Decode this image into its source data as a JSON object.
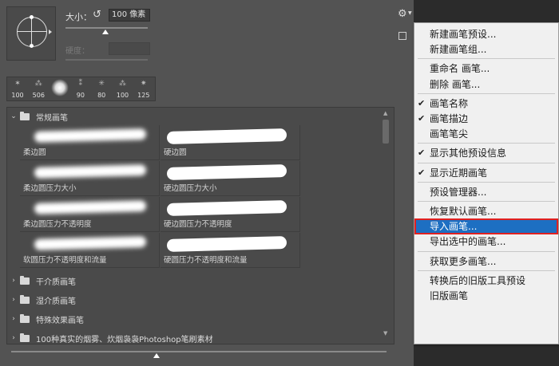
{
  "top": {
    "size_label": "大小：",
    "size_value": "100 像素",
    "hardness_label": "硬度：",
    "reset_icon": "reset-icon",
    "size_slider_fraction": 0.5
  },
  "presets": [
    {
      "num": "100",
      "glyph": "✶"
    },
    {
      "num": "506",
      "glyph": "⁂"
    },
    {
      "num": "",
      "glyph": "soft"
    },
    {
      "num": "90",
      "glyph": "⁑"
    },
    {
      "num": "80",
      "glyph": "✳"
    },
    {
      "num": "100",
      "glyph": "⁂"
    },
    {
      "num": "125",
      "glyph": "✷"
    }
  ],
  "groups": {
    "expanded": {
      "label": "常规画笔"
    },
    "brushes": [
      {
        "label": "柔边圆",
        "hard": false
      },
      {
        "label": "硬边圆",
        "hard": true
      },
      {
        "label": "柔边圆压力大小",
        "hard": false
      },
      {
        "label": "硬边圆压力大小",
        "hard": true
      },
      {
        "label": "柔边圆压力不透明度",
        "hard": false
      },
      {
        "label": "硬边圆压力不透明度",
        "hard": true
      },
      {
        "label": "软圆压力不透明度和流量",
        "hard": false
      },
      {
        "label": "硬圆压力不透明度和流量",
        "hard": true
      }
    ],
    "collapsed": [
      "干介质画笔",
      "湿介质画笔",
      "特殊效果画笔",
      "100种真实的烟雾、炊烟袅袅Photoshop笔刷素材"
    ]
  },
  "menu": {
    "items": [
      {
        "label": "新建画笔预设...",
        "checked": false,
        "highlighted": false
      },
      {
        "label": "新建画笔组...",
        "checked": false,
        "highlighted": false
      },
      {
        "sep": true
      },
      {
        "label": "重命名 画笔...",
        "checked": false,
        "highlighted": false
      },
      {
        "label": "删除 画笔...",
        "checked": false,
        "highlighted": false
      },
      {
        "sep": true
      },
      {
        "label": "画笔名称",
        "checked": true,
        "highlighted": false
      },
      {
        "label": "画笔描边",
        "checked": true,
        "highlighted": false
      },
      {
        "label": "画笔笔尖",
        "checked": false,
        "highlighted": false
      },
      {
        "sep": true
      },
      {
        "label": "显示其他预设信息",
        "checked": true,
        "highlighted": false
      },
      {
        "sep": true
      },
      {
        "label": "显示近期画笔",
        "checked": true,
        "highlighted": false
      },
      {
        "sep": true
      },
      {
        "label": "预设管理器...",
        "checked": false,
        "highlighted": false
      },
      {
        "sep": true
      },
      {
        "label": "恢复默认画笔...",
        "checked": false,
        "highlighted": false
      },
      {
        "label": "导入画笔...",
        "checked": false,
        "highlighted": true
      },
      {
        "label": "导出选中的画笔...",
        "checked": false,
        "highlighted": false
      },
      {
        "sep": true
      },
      {
        "label": "获取更多画笔...",
        "checked": false,
        "highlighted": false
      },
      {
        "sep": true
      },
      {
        "label": "转换后的旧版工具预设",
        "checked": false,
        "highlighted": false
      },
      {
        "label": "旧版画笔",
        "checked": false,
        "highlighted": false
      }
    ]
  },
  "colors": {
    "highlight": "#1d6fc2",
    "highlight_border": "#e02020"
  }
}
